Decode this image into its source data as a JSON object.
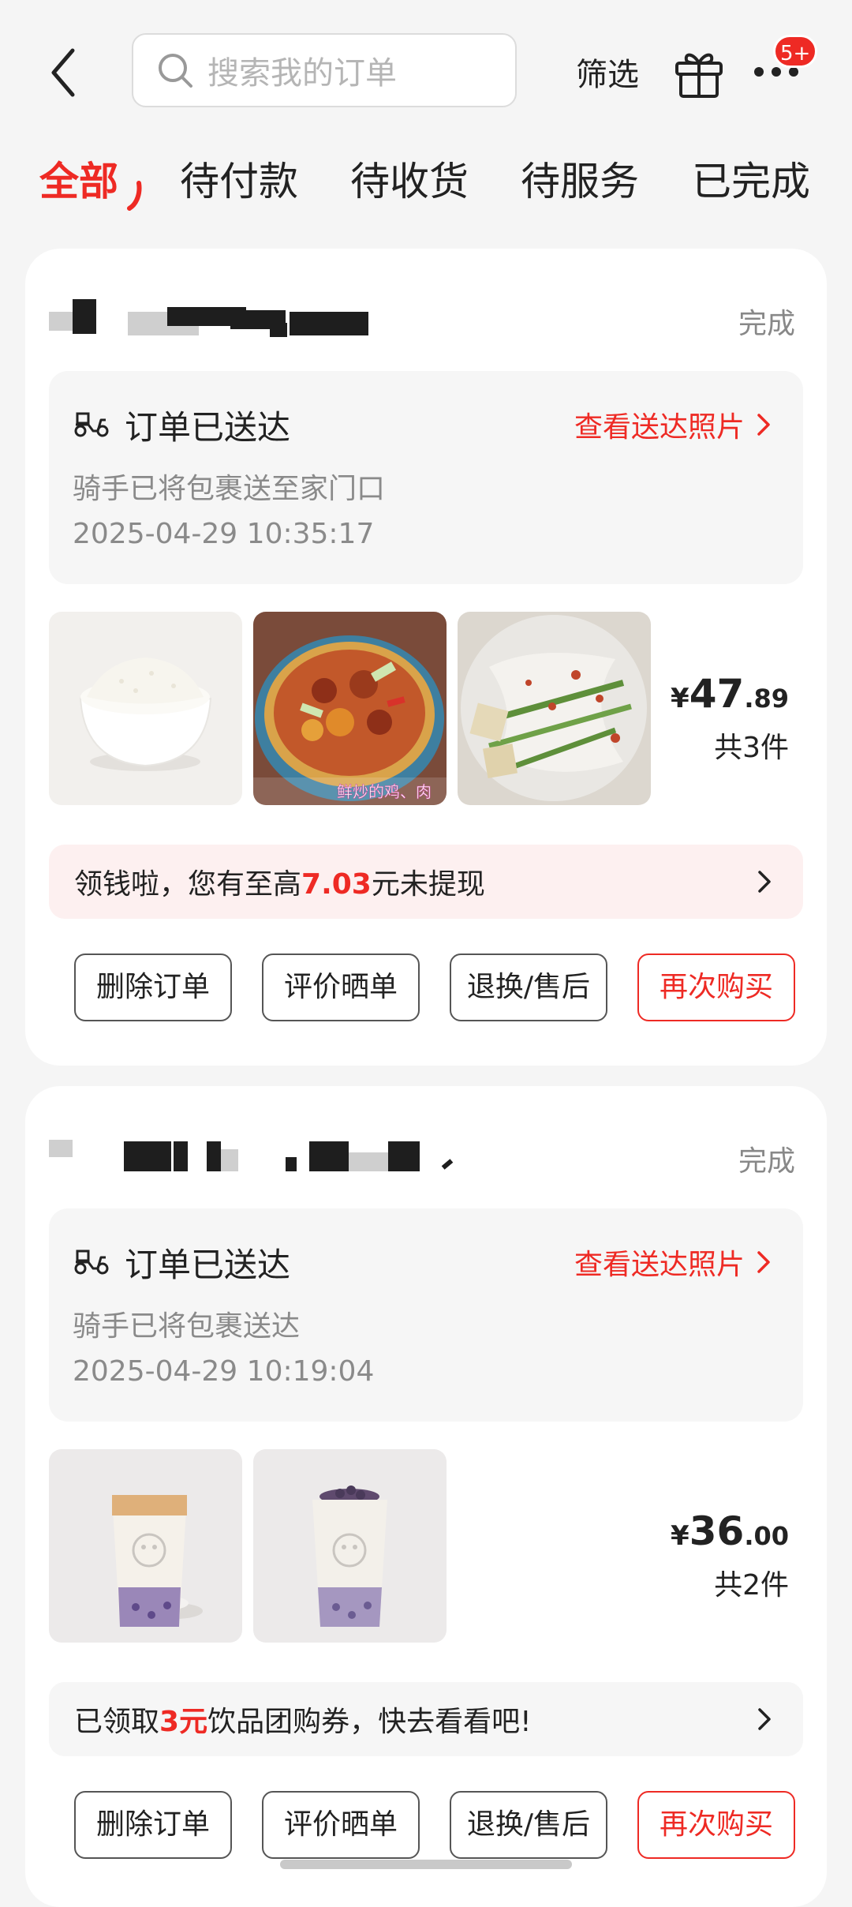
{
  "header": {
    "search_placeholder": "搜索我的订单",
    "filter_label": "筛选",
    "notification_badge": "5+"
  },
  "tabs": [
    {
      "label": "全部",
      "active": true
    },
    {
      "label": "待付款",
      "active": false
    },
    {
      "label": "待收货",
      "active": false
    },
    {
      "label": "待服务",
      "active": false
    },
    {
      "label": "已完成",
      "active": false
    }
  ],
  "orders": [
    {
      "shop_name": "",
      "status": "完成",
      "delivery": {
        "title": "订单已送达",
        "photo_link": "查看送达照片",
        "subtitle": "骑手已将包裹送至家门口",
        "time": "2025-04-29 10:35:17"
      },
      "items": [
        {
          "image": "rice-bowl"
        },
        {
          "image": "stir-fried-chicken",
          "caption": "鲜炒的鸡、肉"
        },
        {
          "image": "cold-noodles"
        }
      ],
      "price": {
        "currency": "¥",
        "integer": "47",
        "decimal": ".89"
      },
      "count_label": "共3件",
      "promo": {
        "prefix": "领钱啦，您有至高",
        "highlight": "7.03",
        "suffix": "元未提现"
      },
      "actions": {
        "delete": "删除订单",
        "review": "评价晒单",
        "after_sale": "退换/售后",
        "rebuy": "再次购买"
      }
    },
    {
      "shop_name": "",
      "status": "完成",
      "delivery": {
        "title": "订单已送达",
        "photo_link": "查看送达照片",
        "subtitle": "骑手已将包裹送达",
        "time": "2025-04-29 10:19:04"
      },
      "items": [
        {
          "image": "milk-tea-cup"
        },
        {
          "image": "taro-milk-tea-cup"
        }
      ],
      "price": {
        "currency": "¥",
        "integer": "36",
        "decimal": ".00"
      },
      "count_label": "共2件",
      "promo": {
        "prefix": "已领取",
        "highlight": "3元",
        "suffix": "饮品团购券，快去看看吧!"
      },
      "actions": {
        "delete": "删除订单",
        "review": "评价晒单",
        "after_sale": "退换/售后",
        "rebuy": "再次购买"
      }
    }
  ],
  "colors": {
    "accent": "#ee2a24",
    "background": "#f5f5f5",
    "card": "#ffffff"
  }
}
